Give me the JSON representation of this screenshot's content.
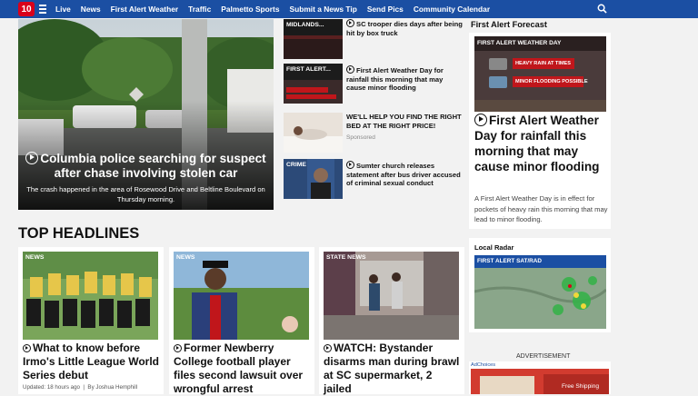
{
  "nav": {
    "logo_text": "10",
    "items": [
      "Live",
      "News",
      "First Alert Weather",
      "Traffic",
      "Palmetto Sports",
      "Submit a News Tip",
      "Send Pics",
      "Community Calendar"
    ]
  },
  "hero": {
    "title": "Columbia police searching for suspect after chase involving stolen car",
    "subtitle": "The crash happened in the area of Rosewood Drive and Beltline Boulevard on Thursday morning."
  },
  "side_stories": [
    {
      "thumb_label": "MIDLANDS...",
      "title": "SC trooper dies days after being hit by box truck",
      "video": true
    },
    {
      "thumb_label": "FIRST ALERT...",
      "title": "First Alert Weather Day for rainfall this morning that may cause minor flooding",
      "video": true
    },
    {
      "thumb_label": "",
      "title": "WE'LL HELP YOU FIND THE RIGHT BED AT THE RIGHT PRICE!",
      "sponsored": "Sponsored",
      "video": false
    },
    {
      "thumb_label": "CRIME",
      "title": "Sumter church releases statement after bus driver accused of criminal sexual conduct",
      "video": true
    }
  ],
  "top_headlines": {
    "heading": "TOP HEADLINES",
    "cards": [
      {
        "tag": "NEWS",
        "title": "What to know before Irmo's Little League World Series debut",
        "meta": "Updated: 18 hours ago  |  By Joshua Hemphill"
      },
      {
        "tag": "NEWS",
        "title": "Former Newberry College football player files second lawsuit over wrongful arrest",
        "meta": ""
      },
      {
        "tag": "STATE NEWS",
        "title": "WATCH: Bystander disarms man during brawl at SC supermarket, 2 jailed",
        "meta": ""
      }
    ]
  },
  "forecast": {
    "heading": "First Alert Forecast",
    "graphic_title": "FIRST ALERT WEATHER DAY",
    "graphic_rows": [
      "HEAVY RAIN AT TIMES",
      "MINOR FLOODING POSSIBLE"
    ],
    "title": "First Alert Weather Day for rainfall this morning that may cause minor flooding",
    "summary": "A First Alert Weather Day is in effect for pockets of heavy rain this morning that may lead to minor flooding."
  },
  "radar": {
    "heading": "Local Radar",
    "map_title": "FIRST ALERT SAT/RAD"
  },
  "advertisement": {
    "label": "ADVERTISEMENT",
    "adchoices": "AdChoices",
    "free_shipping": "Free Shipping"
  },
  "colors": {
    "nav": "#1b4fa3",
    "brand_red": "#d9001b",
    "weather_red": "#c0161b"
  }
}
